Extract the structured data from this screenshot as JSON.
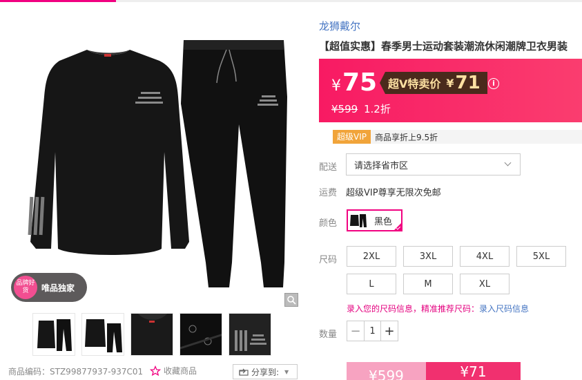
{
  "brand": {
    "name": "龙狮戴尔"
  },
  "product": {
    "title": "【超值实惠】春季男士运动套装潮流休闲潮牌卫衣男装",
    "code_label": "商品编码：",
    "code": "STZ99877937-937C01"
  },
  "gallery": {
    "badge_circle_text": "品牌好货",
    "badge_text": "唯品独家",
    "thumb_count": 5
  },
  "actions": {
    "favorite_label": "收藏商品",
    "share_label": "分享到:"
  },
  "price": {
    "currency": "¥",
    "current": "75",
    "svip_label": "超V特卖价",
    "svip_currency": "¥",
    "svip_price": "71",
    "original": "¥599",
    "discount": "1.2折"
  },
  "vip": {
    "badge": "超级VIP",
    "desc": "商品享折上9.5折"
  },
  "delivery": {
    "label": "配送",
    "placeholder": "请选择省市区"
  },
  "shipping": {
    "label": "运费",
    "text": "超级VIP尊享无限次免邮"
  },
  "color": {
    "label": "颜色",
    "options": [
      {
        "name": "黑色",
        "selected": true
      }
    ]
  },
  "size": {
    "label": "尺码",
    "options": [
      "2XL",
      "3XL",
      "4XL",
      "5XL",
      "L",
      "M",
      "XL"
    ],
    "hint": "录入您的尺码信息，精准推荐尺码：",
    "hint_link": "录入尺码信息"
  },
  "quantity": {
    "label": "数量",
    "value": "1",
    "minus": "−",
    "plus": "+"
  },
  "buy": {
    "original_price": "¥599",
    "svip_price": "¥71"
  },
  "colors": {
    "accent": "#f10180",
    "banner": "#f81a63",
    "link": "#4474c2",
    "vip_gold": "#f1a43a"
  }
}
